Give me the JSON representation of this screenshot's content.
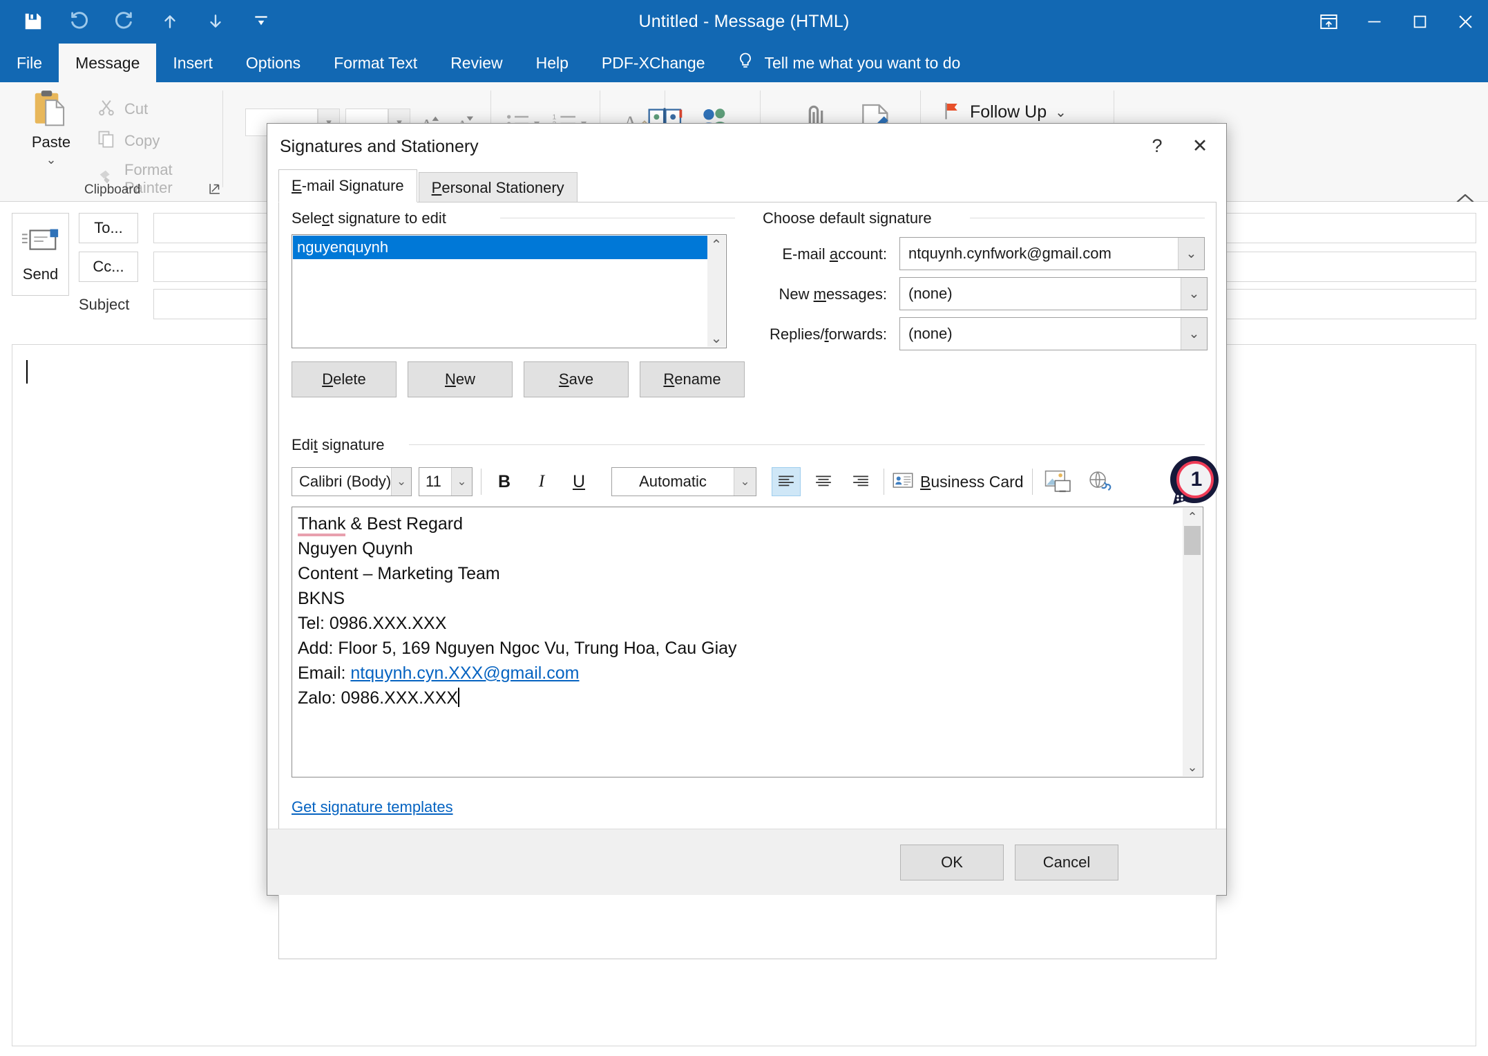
{
  "window": {
    "title": "Untitled  -  Message (HTML)",
    "qat": [
      {
        "name": "save-icon",
        "label": "Save"
      },
      {
        "name": "undo-icon",
        "label": "Undo"
      },
      {
        "name": "redo-icon",
        "label": "Redo"
      },
      {
        "name": "previous-item-icon",
        "label": "Previous Item"
      },
      {
        "name": "next-item-icon",
        "label": "Next Item"
      },
      {
        "name": "customize-quick-access-toolbar-icon",
        "label": "Customize Quick Access Toolbar"
      }
    ],
    "controls": [
      {
        "name": "ribbon-display-options-button",
        "label": "Ribbon Display Options"
      },
      {
        "name": "minimize-button",
        "label": "Minimize"
      },
      {
        "name": "maximize-button",
        "label": "Maximize"
      },
      {
        "name": "close-button",
        "label": "Close"
      }
    ]
  },
  "ribbon": {
    "tabs": [
      {
        "label": "File",
        "active": false
      },
      {
        "label": "Message",
        "active": true
      },
      {
        "label": "Insert",
        "active": false
      },
      {
        "label": "Options",
        "active": false
      },
      {
        "label": "Format Text",
        "active": false
      },
      {
        "label": "Review",
        "active": false
      },
      {
        "label": "Help",
        "active": false
      },
      {
        "label": "PDF-XChange",
        "active": false
      }
    ],
    "tell_me": "Tell me what you want to do",
    "clipboard": {
      "group_label": "Clipboard",
      "paste_label": "Paste",
      "cut_label": "Cut",
      "copy_label": "Copy",
      "format_painter_label": "Format Painter"
    },
    "tags": {
      "follow_up_label": "Follow Up"
    }
  },
  "compose": {
    "send_label": "Send",
    "to_label": "To...",
    "cc_label": "Cc...",
    "subject_label": "Subject",
    "to_value": "",
    "cc_value": "",
    "subject_value": "",
    "body_value": ""
  },
  "dialog": {
    "title": "Signatures and Stationery",
    "help_label": "?",
    "close_label": "✕",
    "tabs": [
      {
        "label": "E-mail Signature",
        "accel": "E",
        "active": true
      },
      {
        "label": "Personal Stationery",
        "accel": "P",
        "active": false
      }
    ],
    "select_signature": {
      "group_label": "Select signature to edit",
      "group_accel": "c",
      "items": [
        "nguyenquynh"
      ],
      "selected_index": 0,
      "buttons": [
        {
          "label": "Delete",
          "accel": "D"
        },
        {
          "label": "New",
          "accel": "N"
        },
        {
          "label": "Save",
          "accel": "S"
        },
        {
          "label": "Rename",
          "accel": "R"
        }
      ]
    },
    "default_signature": {
      "group_label": "Choose default signature",
      "fields": [
        {
          "label": "E-mail account:",
          "accel": "a",
          "value": "ntquynh.cynfwork@gmail.com"
        },
        {
          "label": "New messages:",
          "accel": "m",
          "value": "(none)"
        },
        {
          "label": "Replies/forwards:",
          "accel": "f",
          "value": "(none)"
        }
      ]
    },
    "edit_signature": {
      "group_label": "Edit signature",
      "group_accel": "t",
      "toolbar": {
        "font_family": "Calibri (Body)",
        "font_size": "11",
        "bold_label": "B",
        "italic_label": "I",
        "underline_label": "U",
        "font_color": "Automatic",
        "align_left_label": "Align Left",
        "align_center_label": "Center",
        "align_right_label": "Align Right",
        "business_card_label": "Business Card",
        "business_card_accel": "B",
        "picture_label": "Picture",
        "hyperlink_label": "Hyperlink"
      },
      "content_lines": [
        {
          "text": "Thank & Best Regard",
          "misspelled_prefix": "Thank",
          "rest": " & Best Regard"
        },
        {
          "text": "Nguyen Quynh"
        },
        {
          "text": "Content – Marketing Team"
        },
        {
          "text": "BKNS"
        },
        {
          "text": "Tel: 0986.XXX.XXX"
        },
        {
          "text": "Add: Floor 5, 169 Nguyen Ngoc Vu, Trung Hoa, Cau Giay"
        },
        {
          "text": "Email: ",
          "link": "ntquynh.cyn.XXX@gmail.com"
        },
        {
          "text": "Zalo: 0986.XXX.XXX",
          "caret": true
        }
      ]
    },
    "templates_link": "Get signature templates",
    "footer_buttons": [
      {
        "label": "OK"
      },
      {
        "label": "Cancel"
      }
    ]
  },
  "annotation": {
    "badge_number": "1",
    "badge_ring_color": "#ef3b56",
    "badge_outline_color": "#16193a"
  },
  "colors": {
    "accent": "#1268b3",
    "selection": "#0078d7",
    "link": "#0563c1",
    "spell_error": "#e8a0ae"
  }
}
